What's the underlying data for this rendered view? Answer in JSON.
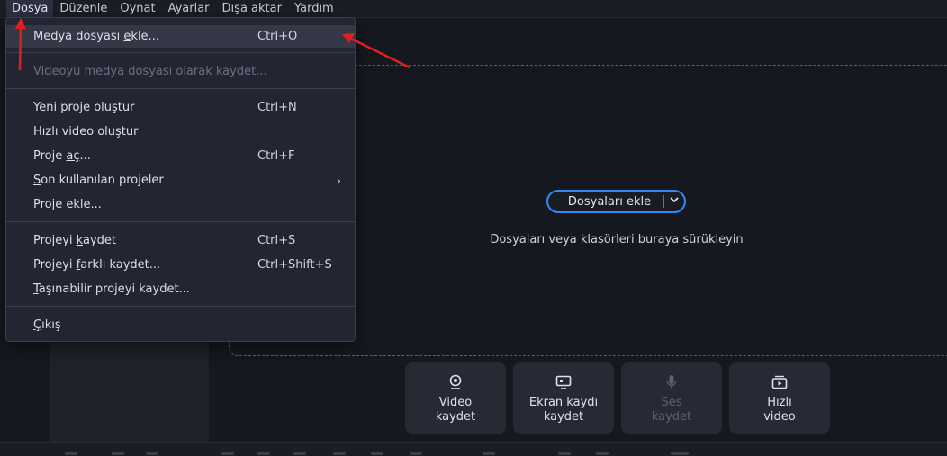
{
  "menubar": [
    {
      "pre": "",
      "u": "D",
      "post": "osya"
    },
    {
      "pre": "D",
      "u": "ü",
      "post": "zenle"
    },
    {
      "pre": "",
      "u": "O",
      "post": "ynat"
    },
    {
      "pre": "",
      "u": "A",
      "post": "yarlar"
    },
    {
      "pre": "D",
      "u": "ı",
      "post": "şa aktar"
    },
    {
      "pre": "",
      "u": "Y",
      "post": "ardım"
    }
  ],
  "file_menu": {
    "items": [
      {
        "pre": "Medya dosyası ",
        "u": "e",
        "post": "kle...",
        "shortcut": "Ctrl+O"
      },
      {
        "pre": "Videoyu ",
        "u": "m",
        "post": "edya dosyası olarak kaydet...",
        "shortcut": ""
      },
      {
        "pre": "",
        "u": "Y",
        "post": "eni proje oluştur",
        "shortcut": "Ctrl+N"
      },
      {
        "pre": "Hızlı video oluştur",
        "u": "",
        "post": "",
        "shortcut": ""
      },
      {
        "pre": "Proje ",
        "u": "aç",
        "post": "...",
        "shortcut": "Ctrl+F"
      },
      {
        "pre": "",
        "u": "S",
        "post": "on kullanılan projeler",
        "shortcut": "",
        "submenu": "›"
      },
      {
        "pre": "Proje ekle...",
        "u": "",
        "post": "",
        "shortcut": ""
      },
      {
        "pre": "Projeyi ",
        "u": "k",
        "post": "aydet",
        "shortcut": "Ctrl+S"
      },
      {
        "pre": "Projeyi ",
        "u": "f",
        "post": "arklı kaydet...",
        "shortcut": "Ctrl+Shift+S"
      },
      {
        "pre": "",
        "u": "T",
        "post": "aşınabilir projeyi kaydet...",
        "shortcut": ""
      },
      {
        "pre": "",
        "u": "Ç",
        "post": "ıkış",
        "shortcut": ""
      }
    ]
  },
  "import": {
    "add_files_label": "Dosyaları ekle",
    "drop_hint": "Dosyaları veya klasörleri buraya sürükleyin"
  },
  "record_buttons": [
    {
      "label": "Video\nkaydet",
      "icon": "webcam-icon"
    },
    {
      "label": "Ekran kaydı\nkaydet",
      "icon": "monitor-icon"
    },
    {
      "label": "Ses\nkaydet",
      "icon": "microphone-icon"
    },
    {
      "label": "Hızlı\nvideo",
      "icon": "quick-video-icon"
    }
  ],
  "colors": {
    "accent": "#2d8cf0",
    "annotation": "#e02020"
  }
}
